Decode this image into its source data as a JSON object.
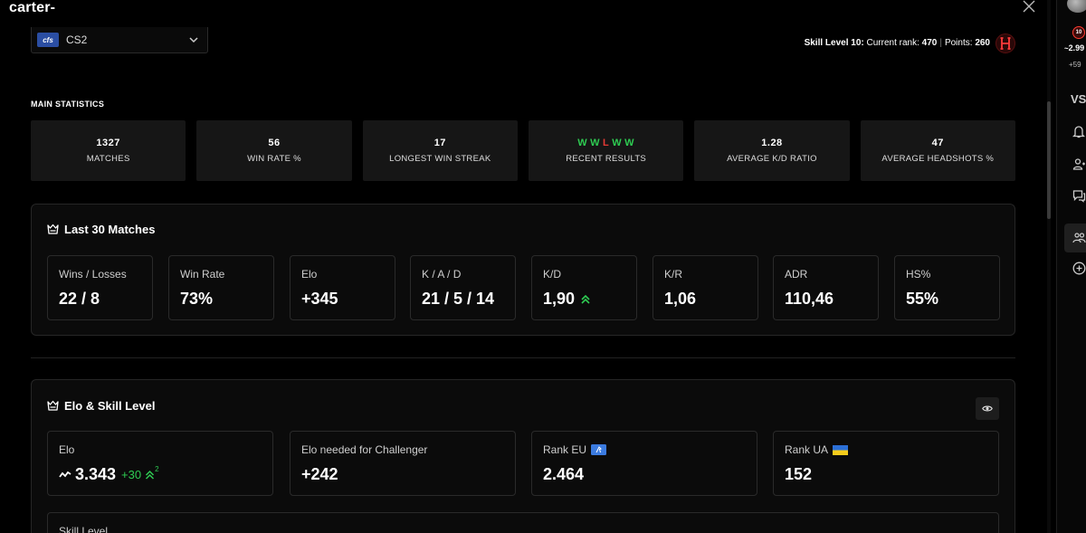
{
  "page": {
    "title": "carter-"
  },
  "game_select": {
    "logo_text": "cfs",
    "value": "CS2"
  },
  "skill_info": {
    "label": "Skill Level 10:",
    "current_rank_label": "Current rank:",
    "current_rank": "470",
    "points_label": "Points:",
    "points": "260"
  },
  "main_statistics": {
    "heading": "MAIN STATISTICS",
    "cards": [
      {
        "value": "1327",
        "label": "MATCHES"
      },
      {
        "value": "56",
        "label": "WIN RATE %"
      },
      {
        "value": "17",
        "label": "LONGEST WIN STREAK"
      },
      {
        "value": "",
        "label": "RECENT RESULTS"
      },
      {
        "value": "1.28",
        "label": "AVERAGE K/D RATIO"
      },
      {
        "value": "47",
        "label": "AVERAGE HEADSHOTS %"
      }
    ],
    "recent_results": [
      "W",
      "W",
      "L",
      "W",
      "W"
    ]
  },
  "last30": {
    "title": "Last 30 Matches",
    "cards": [
      {
        "label": "Wins / Losses",
        "value": "22 / 8"
      },
      {
        "label": "Win Rate",
        "value": "73%"
      },
      {
        "label": "Elo",
        "value": "+345"
      },
      {
        "label": "K / A / D",
        "value": "21 / 5 / 14"
      },
      {
        "label": "K/D",
        "value": "1,90"
      },
      {
        "label": "K/R",
        "value": "1,06"
      },
      {
        "label": "ADR",
        "value": "110,46"
      },
      {
        "label": "HS%",
        "value": "55%"
      }
    ]
  },
  "elo_skill": {
    "title": "Elo & Skill Level",
    "elo": {
      "label": "Elo",
      "value": "3.343",
      "change": "+30",
      "change_sup": "2"
    },
    "challenger": {
      "label": "Elo needed for Challenger",
      "value": "+242"
    },
    "rank_eu": {
      "label": "Rank EU",
      "value": "2.464"
    },
    "rank_ua": {
      "label": "Rank UA",
      "value": "152"
    },
    "skill_level_label": "Skill Level"
  },
  "right_rail": {
    "badge": "10",
    "elo": "2.99",
    "elo_change": "+59",
    "vs": "VS"
  },
  "colors": {
    "win": "#2ecc52",
    "loss": "#e53935",
    "positive": "#2ecc52",
    "brand_red": "#ff5500",
    "background": "#000000",
    "card": "#161616"
  },
  "icons": [
    "close-icon",
    "chevron-down-icon",
    "skill-level-10-icon",
    "crown-icon",
    "eye-icon",
    "trend-icon",
    "double-chevron-up-icon",
    "eu-flag-icon",
    "ua-flag-icon",
    "bell-icon",
    "friends-icon",
    "chat-icon",
    "party-icon",
    "plus-circle-icon"
  ]
}
